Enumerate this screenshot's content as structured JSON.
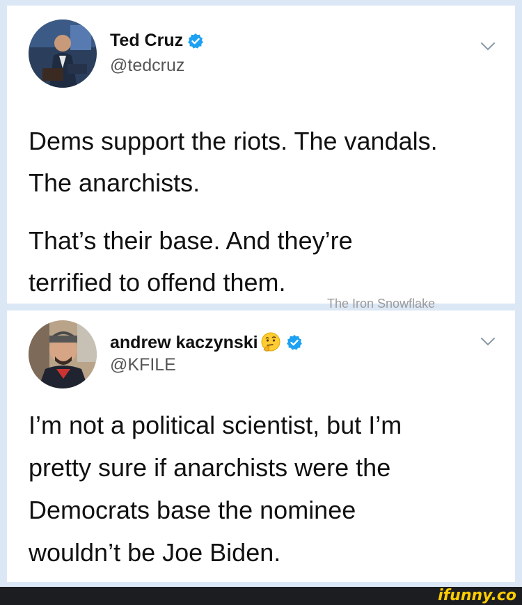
{
  "tweets": [
    {
      "display_name": "Ted Cruz",
      "handle": "@tedcruz",
      "verified": true,
      "body_paragraphs": [
        "Dems support the riots. The vandals. The anarchists.",
        "That’s their base. And they’re terrified to offend them."
      ],
      "body_lines": [
        "Dems support the riots. The vandals.",
        "The anarchists."
      ],
      "body_lines_2": [
        "That’s their base. And they’re",
        "terrified to offend them."
      ]
    },
    {
      "display_name": "andrew kaczynski",
      "name_emoji": "thinking-face-emoji",
      "handle": "@KFILE",
      "verified": true,
      "body_lines": [
        "I’m not a political scientist, but I’m",
        "pretty sure if anarchists were the",
        "Democrats base the nominee",
        "wouldn’t be Joe Biden."
      ]
    }
  ],
  "watermark": "The Iron Snowflake",
  "footer": {
    "brand": "ifunny.co"
  },
  "colors": {
    "background": "#dce7f5",
    "card": "#ffffff",
    "verified_blue": "#1da1f2",
    "footer_bg": "#1c1d21",
    "brand_yellow": "#ffcc00"
  }
}
